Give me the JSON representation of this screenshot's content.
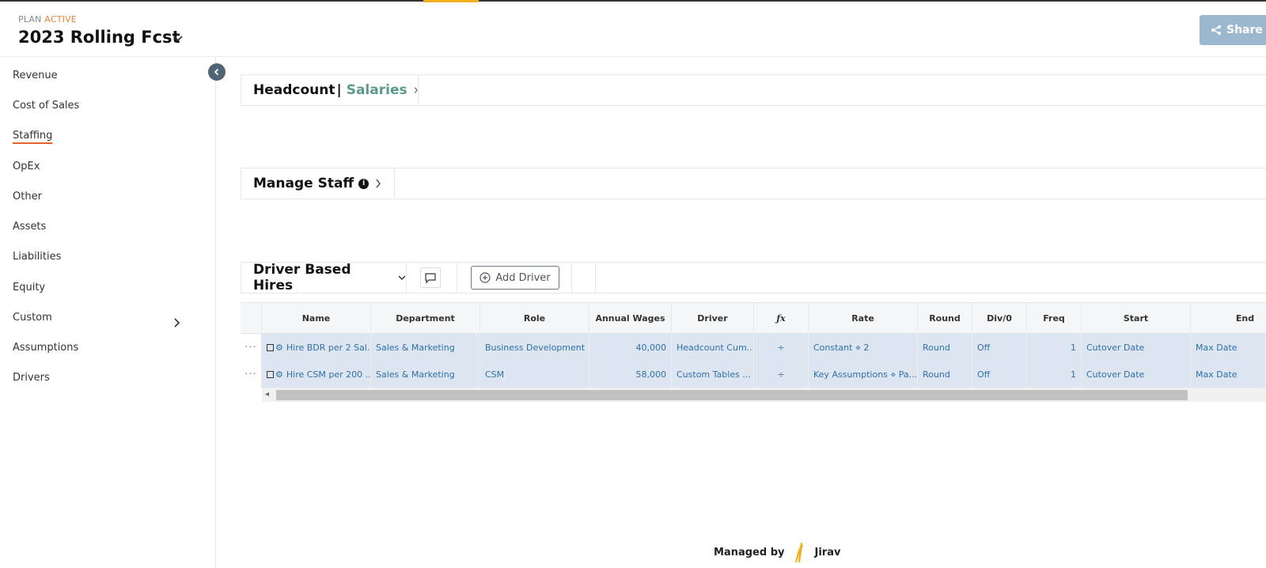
{
  "header": {
    "plan_label": "PLAN",
    "plan_status": "ACTIVE",
    "plan_title": "2023 Rolling Fcst",
    "share_label": "Share"
  },
  "sidebar": {
    "items": [
      {
        "label": "Revenue"
      },
      {
        "label": "Cost of Sales"
      },
      {
        "label": "Staffing",
        "active": true
      },
      {
        "label": "OpEx"
      },
      {
        "label": "Other"
      },
      {
        "label": "Assets"
      },
      {
        "label": "Liabilities"
      },
      {
        "label": "Equity"
      },
      {
        "label": "Custom",
        "has_submenu": true
      },
      {
        "label": "Assumptions"
      },
      {
        "label": "Drivers"
      }
    ]
  },
  "panels": {
    "headcount": {
      "title": "Headcount",
      "separator": "|",
      "subtitle": "Salaries"
    },
    "manage_staff": {
      "title": "Manage Staff"
    },
    "driver_hires": {
      "title": "Driver Based Hires",
      "add_driver_label": "Add Driver"
    }
  },
  "grid": {
    "columns": [
      "Name",
      "Department",
      "Role",
      "Annual Wages",
      "Driver",
      "ƒx",
      "Rate",
      "Round",
      "Div/0",
      "Freq",
      "Start",
      "End"
    ],
    "rows": [
      {
        "name": "Hire BDR per 2 Sal...",
        "department": "Sales & Marketing",
        "role": "Business Development",
        "annual_wages": "40,000",
        "driver": "Headcount Cum...",
        "fx": "÷",
        "rate": "Constant ⋄ 2",
        "round": "Round",
        "div0": "Off",
        "freq": "1",
        "start": "Cutover Date",
        "end": "Max Date"
      },
      {
        "name": "Hire CSM per 200 ...",
        "department": "Sales & Marketing",
        "role": "CSM",
        "annual_wages": "58,000",
        "driver": "Custom Tables ...",
        "fx": "÷",
        "rate": "Key Assumptions ⋄ Pa...",
        "round": "Round",
        "div0": "Off",
        "freq": "1",
        "start": "Cutover Date",
        "end": "Max Date"
      }
    ]
  },
  "footer": {
    "managed_by": "Managed by",
    "brand": "Jirav"
  },
  "colors": {
    "accent_orange": "#e8833a",
    "share_bg": "#9bb8cf",
    "row_highlight": "#dde6f0",
    "link_blue": "#2f6fa8",
    "salaries_green": "#5a9a8a",
    "brand_yellow": "#f2b01e"
  }
}
